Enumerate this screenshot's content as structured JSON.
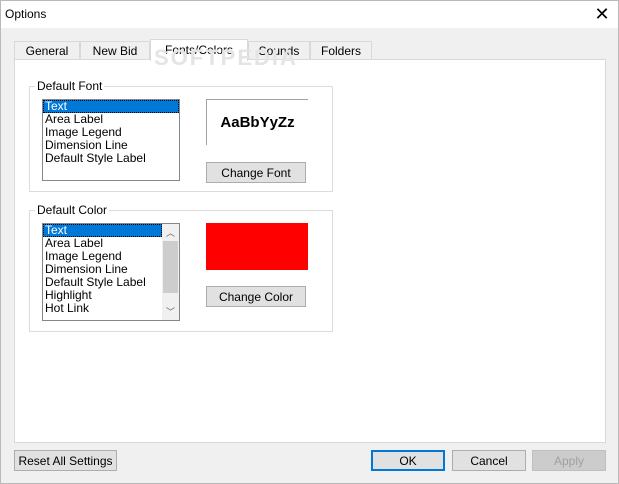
{
  "window": {
    "title": "Options"
  },
  "watermark": "SOFTPEDIA",
  "tabs": [
    {
      "label": "General"
    },
    {
      "label": "New Bid"
    },
    {
      "label": "Fonts/Colors"
    },
    {
      "label": "Sounds"
    },
    {
      "label": "Folders"
    }
  ],
  "active_tab": "Fonts/Colors",
  "default_font": {
    "label": "Default Font",
    "items": [
      "Text",
      "Area Label",
      "Image Legend",
      "Dimension Line",
      "Default Style Label"
    ],
    "selected": "Text",
    "preview_text": "AaBbYyZz",
    "button_label": "Change Font"
  },
  "default_color": {
    "label": "Default Color",
    "items": [
      "Text",
      "Area Label",
      "Image Legend",
      "Dimension Line",
      "Default Style Label",
      "Highlight",
      "Hot Link"
    ],
    "selected": "Text",
    "swatch_color": "#ff0000",
    "button_label": "Change Color"
  },
  "footer": {
    "reset_label": "Reset All Settings",
    "ok_label": "OK",
    "cancel_label": "Cancel",
    "apply_label": "Apply"
  },
  "colors": {
    "accent": "#0078d7"
  }
}
